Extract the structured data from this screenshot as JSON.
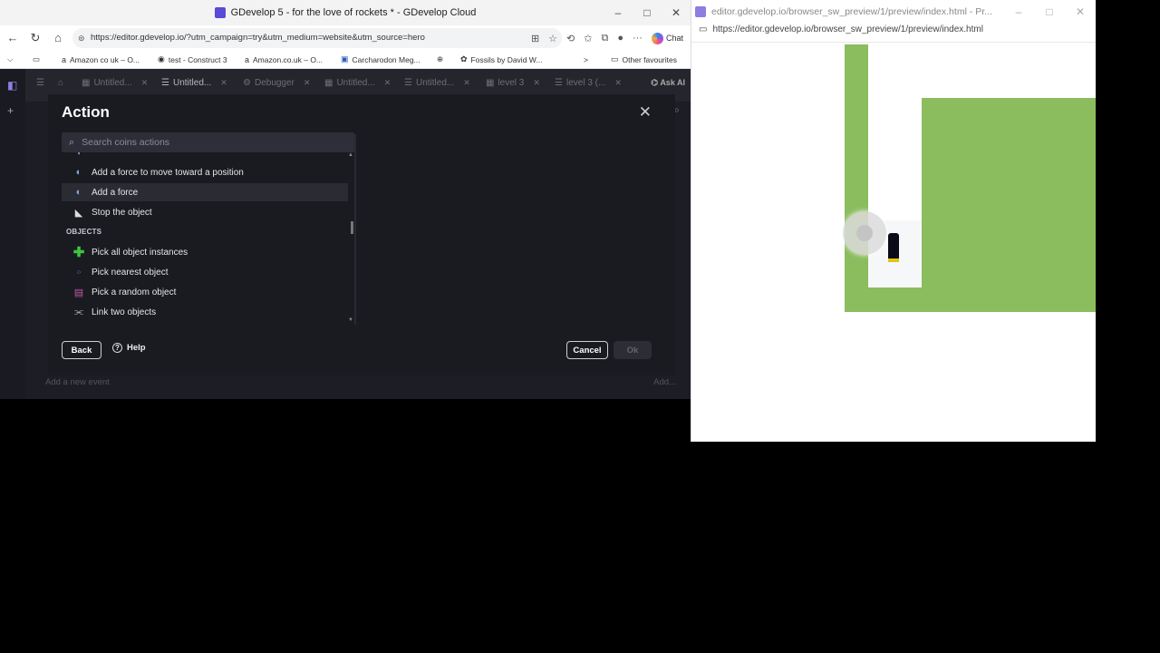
{
  "left_window": {
    "title": "GDevelop 5 - for the love of rockets * - GDevelop Cloud",
    "controls": [
      "–",
      "□",
      "✕"
    ],
    "url": "https://editor.gdevelop.io/?utm_campaign=try&utm_medium=website&utm_source=hero",
    "chat_label": "Chat",
    "bookmarks": [
      "Amazon co uk – O...",
      "test - Construct 3",
      "Amazon.co.uk – O...",
      "Carcharodon Meg...",
      "Fossils by David W..."
    ],
    "bookmarks_more": ">",
    "other_favourites": "Other favourites"
  },
  "gdevelop": {
    "tabs": [
      "Untitled...",
      "Untitled...",
      "Debugger",
      "Untitled...",
      "Untitled...",
      "level 3",
      "level 3 (..."
    ],
    "ask_ai": "Ask AI",
    "add_event": "Add a new event",
    "add_right": "Add..."
  },
  "dialog": {
    "title": "Action",
    "close": "✕",
    "search_placeholder": "Search coins actions",
    "rows": [
      {
        "label": "Add a force to move toward a position",
        "icon": "force-icon"
      },
      {
        "label": "Add a force",
        "icon": "force-icon"
      },
      {
        "label": "Stop the object",
        "icon": "stop-icon"
      }
    ],
    "section_objects": "OBJECTS",
    "object_rows": [
      {
        "label": "Pick all object instances",
        "icon": "plus-icon"
      },
      {
        "label": "Pick nearest object",
        "icon": "nearest-icon"
      },
      {
        "label": "Pick a random object",
        "icon": "random-icon"
      },
      {
        "label": "Link two objects",
        "icon": "link-icon"
      }
    ],
    "back_label": "Back",
    "help_label": "Help",
    "cancel_label": "Cancel",
    "ok_label": "Ok"
  },
  "right_window": {
    "title": "editor.gdevelop.io/browser_sw_preview/1/preview/index.html - Pr...",
    "url": "https://editor.gdevelop.io/browser_sw_preview/1/preview/index.html",
    "controls": [
      "–",
      "□",
      "✕"
    ]
  },
  "colors": {
    "accent": "#9b8ff0",
    "dialog_bg": "#1a1a21",
    "game_green": "#8bbc5d"
  }
}
